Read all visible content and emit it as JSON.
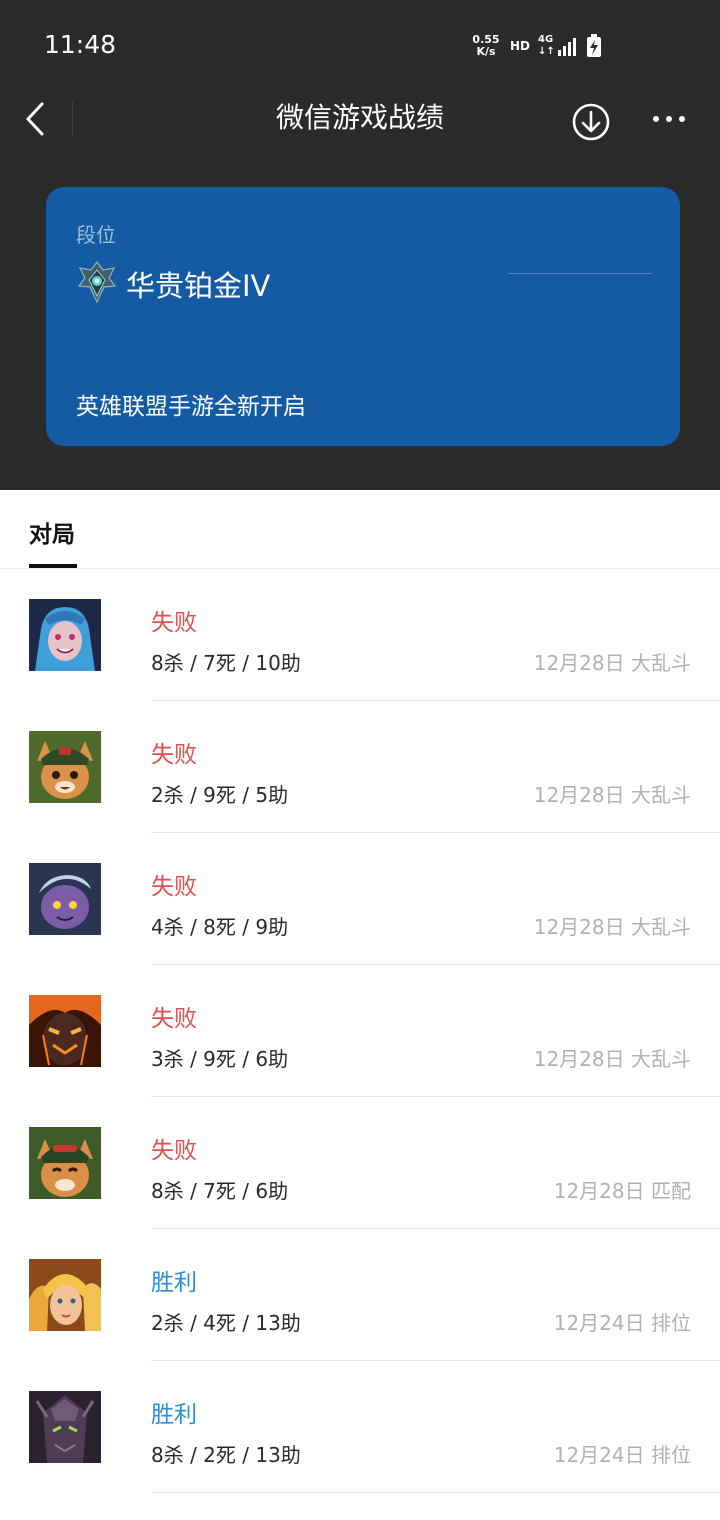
{
  "status_bar": {
    "time": "11:48",
    "speed_value": "0.55",
    "speed_unit": "K/s",
    "hd": "HD",
    "network": "4G"
  },
  "header": {
    "title": "微信游戏战绩"
  },
  "rank_card": {
    "label": "段位",
    "rank": "华贵铂金IV",
    "subtitle": "英雄联盟手游全新开启",
    "bg_color": "#155ba3"
  },
  "tabs": [
    {
      "label": "对局",
      "active": true
    }
  ],
  "matches": [
    {
      "result": "失败",
      "outcome": "loss",
      "kda": "8杀 / 7死 / 10助",
      "meta": "12月28日 大乱斗",
      "avatar": "jinx-champion-avatar"
    },
    {
      "result": "失败",
      "outcome": "loss",
      "kda": "2杀 / 9死 / 5助",
      "meta": "12月28日 大乱斗",
      "avatar": "teemo-champion-avatar"
    },
    {
      "result": "失败",
      "outcome": "loss",
      "kda": "4杀 / 8死 / 9助",
      "meta": "12月28日 大乱斗",
      "avatar": "tristana-champion-avatar"
    },
    {
      "result": "失败",
      "outcome": "loss",
      "kda": "3杀 / 9死 / 6助",
      "meta": "12月28日 大乱斗",
      "avatar": "brand-champion-avatar"
    },
    {
      "result": "失败",
      "outcome": "loss",
      "kda": "8杀 / 7死 / 6助",
      "meta": "12月28日 匹配",
      "avatar": "teemo-champion-avatar"
    },
    {
      "result": "胜利",
      "outcome": "win",
      "kda": "2杀 / 4死 / 13助",
      "meta": "12月24日 排位",
      "avatar": "lux-champion-avatar"
    },
    {
      "result": "胜利",
      "outcome": "win",
      "kda": "8杀 / 2死 / 13助",
      "meta": "12月24日 排位",
      "avatar": "malzahar-champion-avatar"
    }
  ],
  "colors": {
    "header_bg": "#2b2b2b",
    "loss": "#e0504e",
    "win": "#2c8fd6",
    "meta_text": "#b0b0b0"
  }
}
